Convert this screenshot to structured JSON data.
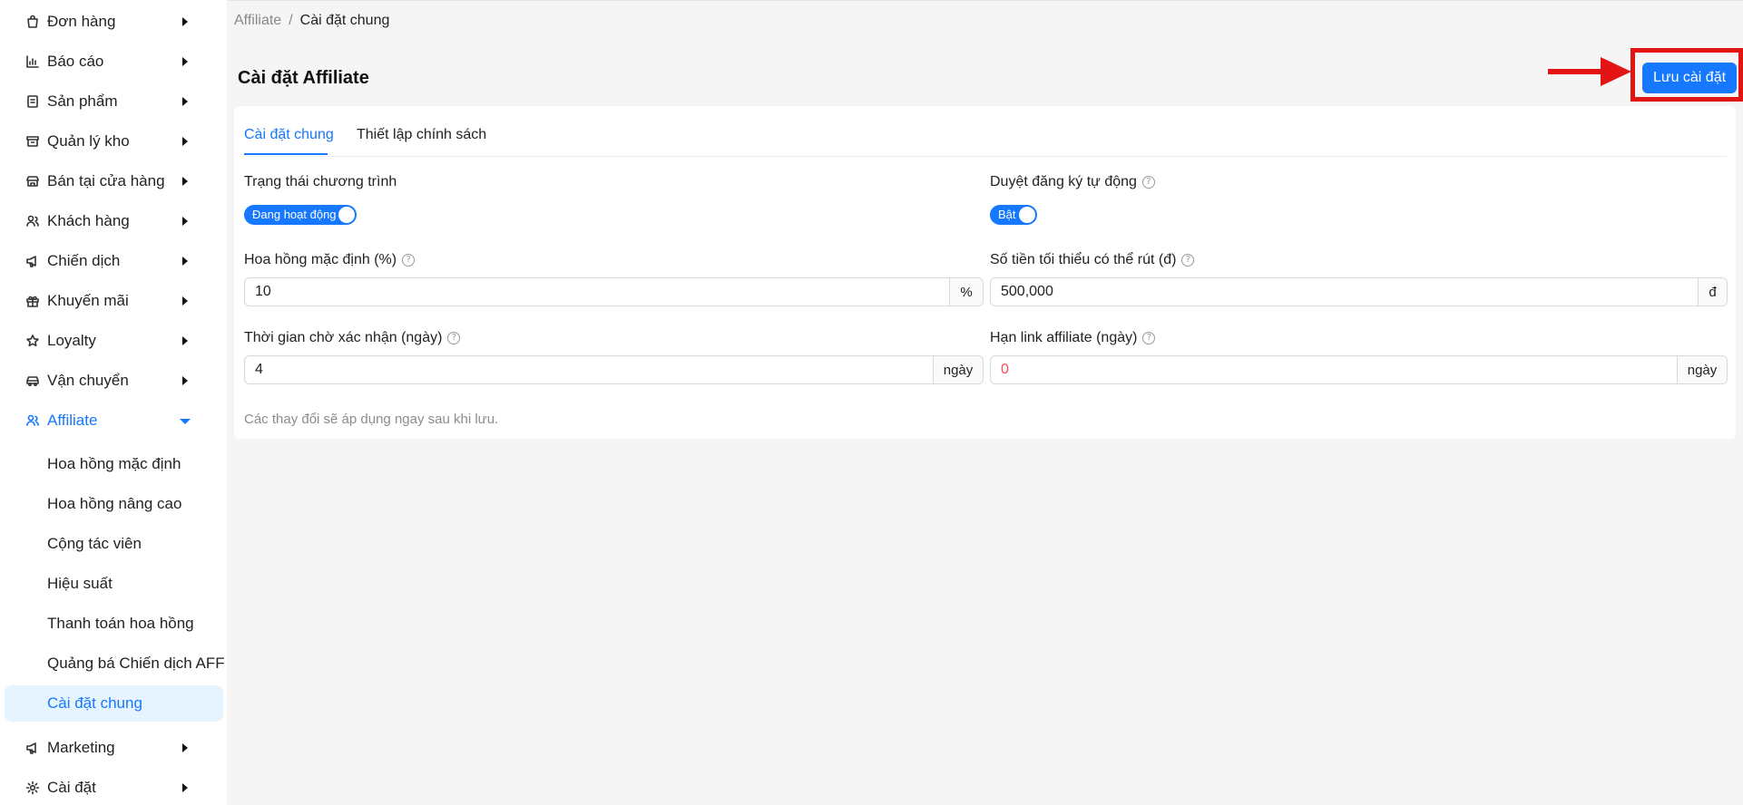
{
  "sidebar": {
    "items": [
      {
        "label": "Đơn hàng",
        "icon": "shopping-bag-icon"
      },
      {
        "label": "Báo cáo",
        "icon": "bar-chart-icon"
      },
      {
        "label": "Sản phẩm",
        "icon": "document-icon"
      },
      {
        "label": "Quản lý kho",
        "icon": "archive-icon"
      },
      {
        "label": "Bán tại cửa hàng",
        "icon": "store-icon"
      },
      {
        "label": "Khách hàng",
        "icon": "users-icon"
      },
      {
        "label": "Chiến dịch",
        "icon": "megaphone-icon"
      },
      {
        "label": "Khuyến mãi",
        "icon": "gift-icon"
      },
      {
        "label": "Loyalty",
        "icon": "star-icon"
      },
      {
        "label": "Vận chuyển",
        "icon": "car-icon"
      },
      {
        "label": "Affiliate",
        "icon": "affiliate-users-icon"
      }
    ],
    "affiliate_sub": [
      {
        "label": "Hoa hồng mặc định"
      },
      {
        "label": "Hoa hồng nâng cao"
      },
      {
        "label": "Cộng tác viên"
      },
      {
        "label": "Hiệu suất"
      },
      {
        "label": "Thanh toán hoa hồng"
      },
      {
        "label": "Quảng bá Chiến dịch AFF"
      },
      {
        "label": "Cài đặt chung"
      }
    ],
    "bottom_items": [
      {
        "label": "Marketing",
        "icon": "megaphone-icon"
      },
      {
        "label": "Cài đặt",
        "icon": "gear-icon"
      }
    ]
  },
  "breadcrumb": {
    "parent": "Affiliate",
    "separator": "/",
    "current": "Cài đặt chung"
  },
  "page": {
    "title": "Cài đặt Affiliate",
    "save_label": "Lưu cài đặt"
  },
  "tabs": [
    {
      "label": "Cài đặt chung"
    },
    {
      "label": "Thiết lập chính sách"
    }
  ],
  "form": {
    "program_status": {
      "label": "Trạng thái chương trình",
      "toggle_text": "Đang hoạt động",
      "on": true
    },
    "auto_approve": {
      "label": "Duyệt đăng ký tự động",
      "toggle_text": "Bật",
      "on": true
    },
    "default_commission": {
      "label": "Hoa hồng mặc định (%)",
      "value": "10",
      "suffix": "%"
    },
    "min_withdraw": {
      "label": "Số tiền tối thiểu có thể rút (đ)",
      "value": "500,000",
      "suffix": "đ"
    },
    "confirm_wait": {
      "label": "Thời gian chờ xác nhận (ngày)",
      "value": "4",
      "suffix": "ngày"
    },
    "link_expiry": {
      "label": "Hạn link affiliate (ngày)",
      "value": "0",
      "suffix": "ngày"
    },
    "hint": "Các thay đổi sẽ áp dụng ngay sau khi lưu."
  },
  "colors": {
    "accent": "#1677ff",
    "highlight": "#e31414",
    "selected_bg": "#e6f4ff"
  }
}
